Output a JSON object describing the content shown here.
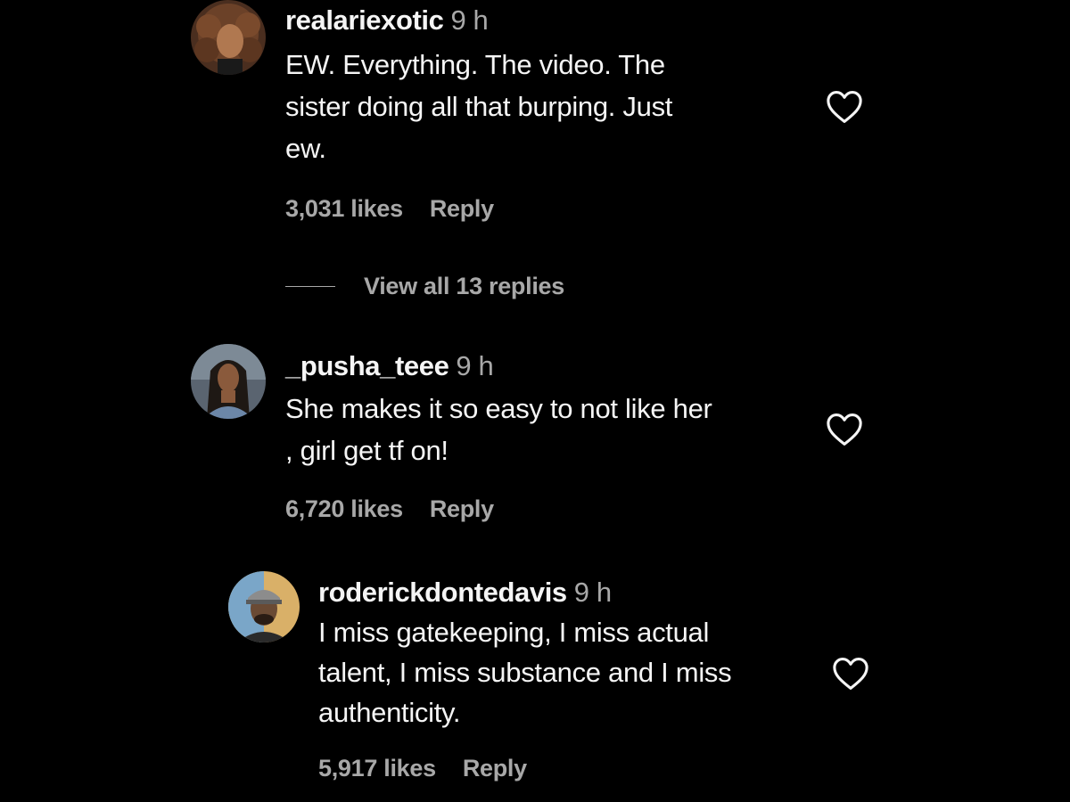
{
  "comments": [
    {
      "username": "realariexotic",
      "time": "9 h",
      "lines": [
        "EW. Everything. The video. The",
        "sister doing all that burping. Just",
        "ew."
      ],
      "likes": "3,031 likes",
      "reply": "Reply",
      "avatar_icon": "avatar-photo-curly-hair",
      "like_icon": "heart-outline-icon"
    },
    {
      "username": "_pusha_teee",
      "time": "9 h",
      "lines": [
        "She makes it so easy to not like her",
        ", girl get tf on!"
      ],
      "likes": "6,720 likes",
      "reply": "Reply",
      "avatar_icon": "avatar-photo-long-hair",
      "like_icon": "heart-outline-icon"
    },
    {
      "username": "roderickdontedavis",
      "time": "9 h",
      "lines": [
        "I miss gatekeeping, I miss actual",
        "talent, I miss substance and I miss",
        "authenticity."
      ],
      "likes": "5,917 likes",
      "reply": "Reply",
      "avatar_icon": "avatar-photo-cap",
      "like_icon": "heart-outline-icon"
    }
  ],
  "view_replies": "View all 13 replies",
  "colors": {
    "background": "#000000",
    "primary_text": "#f5f5f5",
    "secondary_text": "#a8a8a8"
  }
}
